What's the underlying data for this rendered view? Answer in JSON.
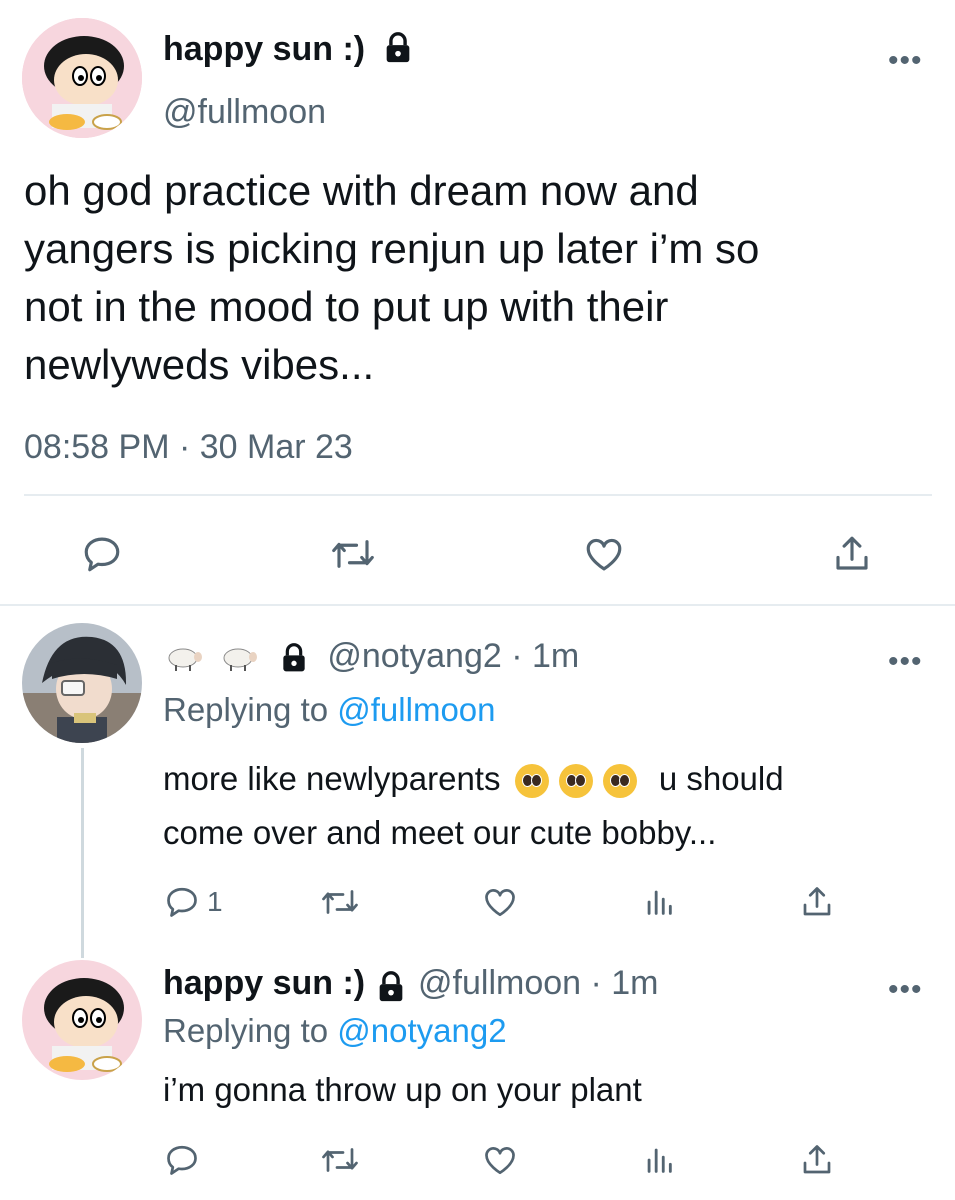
{
  "main_tweet": {
    "name": "happy sun :)",
    "handle": "@fullmoon",
    "text_lines": [
      "oh god practice with dream now and",
      "yangers is picking renjun up later i’m so",
      "not in the mood to put up with their",
      "newlyweds vibes..."
    ],
    "timestamp": "08:58 PM · 30 Mar 23",
    "more": "•••"
  },
  "reply1": {
    "name_emoji": "sheep-sheep",
    "handle_time": "@notyang2 · 1m",
    "replying_prefix": "Replying to ",
    "replying_to": "@fullmoon",
    "text_part1": "more like newlyparents",
    "text_part2": "u should",
    "text_line2": "come over and meet our cute bobby...",
    "reply_count": "1",
    "more": "•••"
  },
  "reply2": {
    "name": "happy sun :)",
    "handle_time": "@fullmoon · 1m",
    "replying_prefix": "Replying to ",
    "replying_to": "@notyang2",
    "text": "i’m gonna throw up on your plant",
    "more": "•••"
  },
  "colors": {
    "text": "#0f1419",
    "secondary": "#536471",
    "link": "#1d9bf0",
    "divider": "#e6ecf0"
  }
}
